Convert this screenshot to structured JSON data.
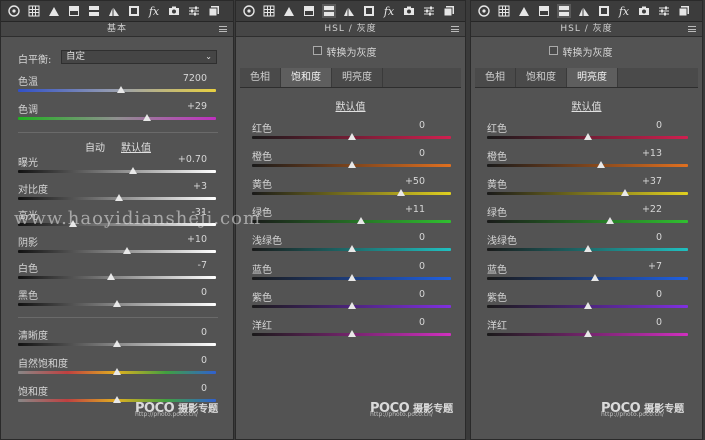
{
  "toolbar_icons": [
    "aperture-icon",
    "grid-icon",
    "tone-curve-icon",
    "split-toning-icon",
    "hsl-icon",
    "detail-icon",
    "lens-icon",
    "fx-icon",
    "camera-icon",
    "sliders-icon",
    "presets-icon"
  ],
  "panel_basic": {
    "title": "基本",
    "wb_label": "白平衡:",
    "wb_value": "自定",
    "sliders_top": [
      {
        "label": "色温",
        "value": "7200",
        "pos": 0.52,
        "track": "temp"
      },
      {
        "label": "色调",
        "value": "+29",
        "pos": 0.65,
        "track": "tint"
      }
    ],
    "auto_label": "自动",
    "default_label": "默认值",
    "sliders": [
      {
        "label": "曝光",
        "value": "+0.70",
        "pos": 0.58,
        "track": "gray"
      },
      {
        "label": "对比度",
        "value": "+3",
        "pos": 0.51,
        "track": "gray"
      },
      {
        "label": "高光",
        "value": "-31",
        "pos": 0.28,
        "track": "gray"
      },
      {
        "label": "阴影",
        "value": "+10",
        "pos": 0.55,
        "track": "gray"
      },
      {
        "label": "白色",
        "value": "-7",
        "pos": 0.47,
        "track": "gray"
      },
      {
        "label": "黑色",
        "value": "0",
        "pos": 0.5,
        "track": "gray"
      }
    ],
    "sliders_bottom": [
      {
        "label": "清晰度",
        "value": "0",
        "pos": 0.5,
        "track": "gray"
      },
      {
        "label": "自然饱和度",
        "value": "0",
        "pos": 0.5,
        "track": "vib"
      },
      {
        "label": "饱和度",
        "value": "0",
        "pos": 0.5,
        "track": "vib"
      }
    ]
  },
  "panel_hsl_sat": {
    "title": "HSL / 灰度",
    "convert_label": "转换为灰度",
    "tabs": [
      "色相",
      "饱和度",
      "明亮度"
    ],
    "active_tab": 1,
    "default_label": "默认值",
    "sliders": [
      {
        "label": "红色",
        "value": "0",
        "pos": 0.5,
        "track": "red"
      },
      {
        "label": "橙色",
        "value": "0",
        "pos": 0.5,
        "track": "orange"
      },
      {
        "label": "黄色",
        "value": "+50",
        "pos": 0.75,
        "track": "yellow"
      },
      {
        "label": "绿色",
        "value": "+11",
        "pos": 0.55,
        "track": "green"
      },
      {
        "label": "浅绿色",
        "value": "0",
        "pos": 0.5,
        "track": "aqua"
      },
      {
        "label": "蓝色",
        "value": "0",
        "pos": 0.5,
        "track": "blue"
      },
      {
        "label": "紫色",
        "value": "0",
        "pos": 0.5,
        "track": "purple"
      },
      {
        "label": "洋红",
        "value": "0",
        "pos": 0.5,
        "track": "magenta"
      }
    ]
  },
  "panel_hsl_lum": {
    "title": "HSL / 灰度",
    "convert_label": "转换为灰度",
    "tabs": [
      "色相",
      "饱和度",
      "明亮度"
    ],
    "active_tab": 2,
    "default_label": "默认值",
    "sliders": [
      {
        "label": "红色",
        "value": "0",
        "pos": 0.5,
        "track": "red"
      },
      {
        "label": "橙色",
        "value": "+13",
        "pos": 0.565,
        "track": "orange"
      },
      {
        "label": "黄色",
        "value": "+37",
        "pos": 0.685,
        "track": "yellow"
      },
      {
        "label": "绿色",
        "value": "+22",
        "pos": 0.61,
        "track": "green"
      },
      {
        "label": "浅绿色",
        "value": "0",
        "pos": 0.5,
        "track": "aqua"
      },
      {
        "label": "蓝色",
        "value": "+7",
        "pos": 0.535,
        "track": "blue"
      },
      {
        "label": "紫色",
        "value": "0",
        "pos": 0.5,
        "track": "purple"
      },
      {
        "label": "洋红",
        "value": "0",
        "pos": 0.5,
        "track": "magenta"
      }
    ]
  },
  "watermark": "www.haoyidiansheji.com",
  "logo": {
    "poco": "POCO",
    "cn": "摄影专题",
    "url": "http://photo.poco.cn/"
  }
}
